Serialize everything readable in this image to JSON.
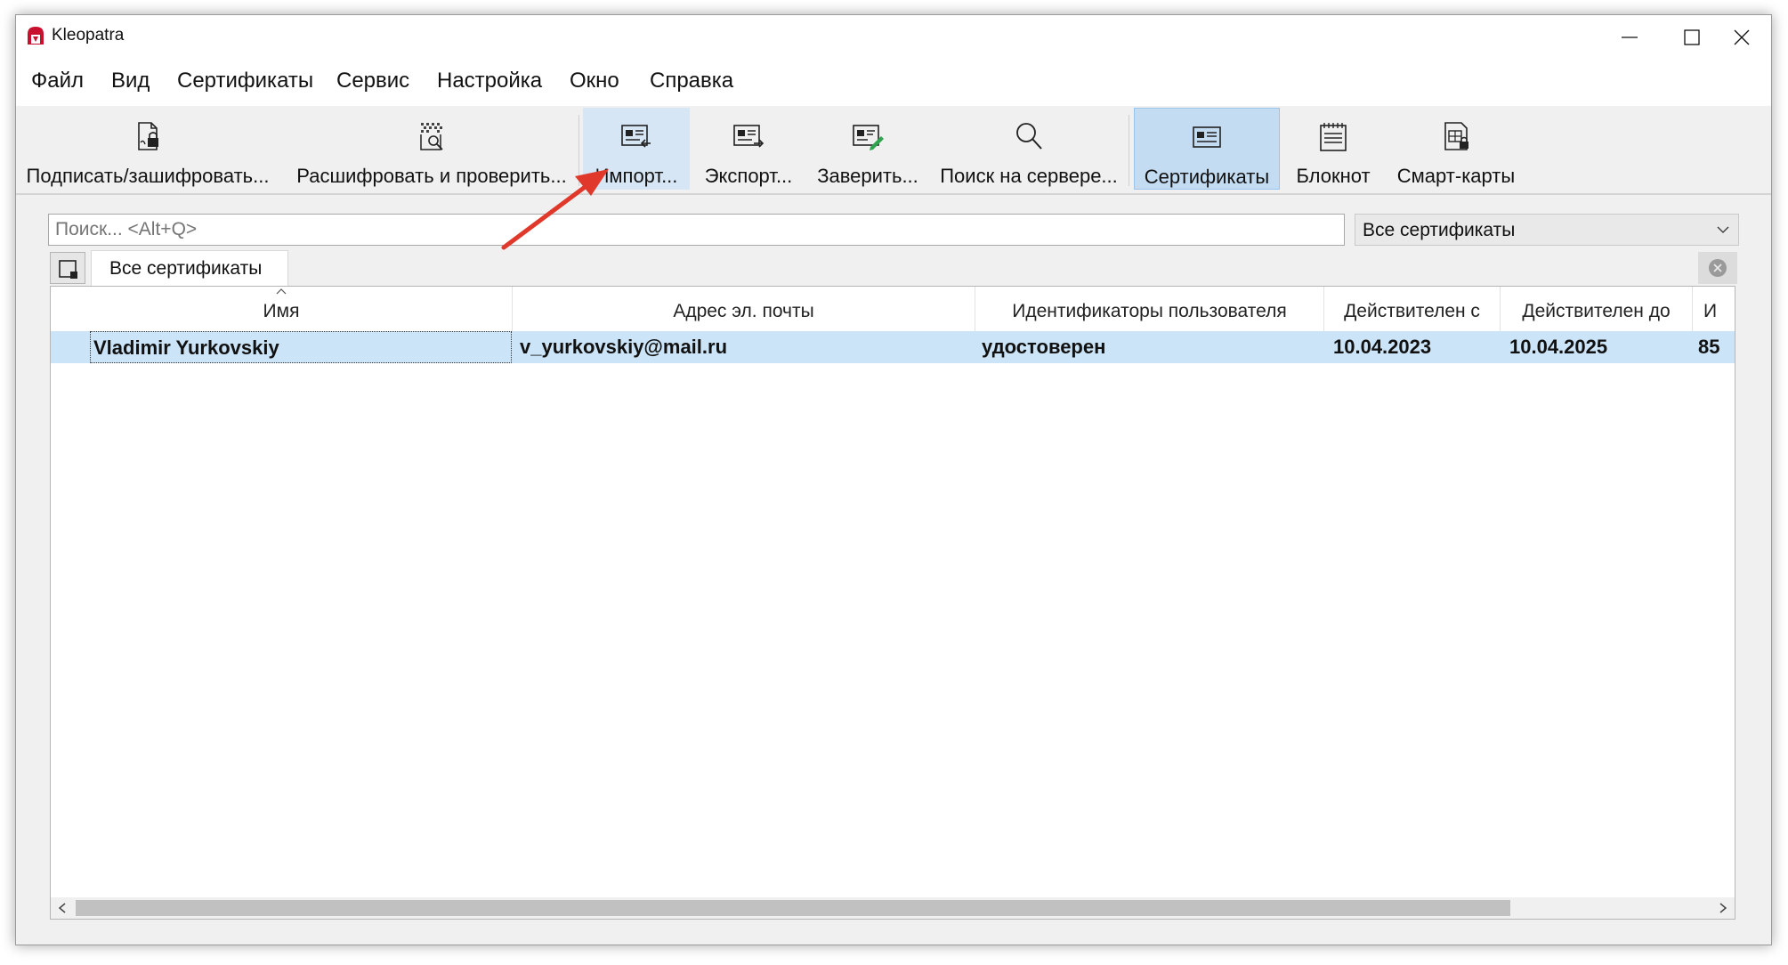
{
  "window": {
    "title": "Kleopatra"
  },
  "menubar": {
    "items": [
      "Файл",
      "Вид",
      "Сертификаты",
      "Сервис",
      "Настройка",
      "Окно",
      "Справка"
    ]
  },
  "toolbar": {
    "sign_encrypt": "Подписать/зашифровать...",
    "decrypt_verify": "Расшифровать и проверить...",
    "import": "Импорт...",
    "export": "Экспорт...",
    "certify": "Заверить...",
    "lookup": "Поиск на сервере...",
    "certificates": "Сертификаты",
    "notepad": "Блокнот",
    "smartcards": "Смарт-карты"
  },
  "search": {
    "placeholder": "Поиск... <Alt+Q>",
    "value": ""
  },
  "filter": {
    "selected": "Все сертификаты"
  },
  "tabs": [
    {
      "label": "Все сертификаты"
    }
  ],
  "table": {
    "columns": [
      "Имя",
      "Адрес эл. почты",
      "Идентификаторы пользователя",
      "Действителен с",
      "Действителен до",
      "И"
    ],
    "rows": [
      {
        "name": "Vladimir Yurkovskiy",
        "email": "v_yurkovskiy@mail.ru",
        "user_ids": "удостоверен",
        "valid_from": "10.04.2023",
        "valid_until": "10.04.2025",
        "id": "85"
      }
    ]
  },
  "colors": {
    "selection": "#cce4f7",
    "toolbar_active": "#c4dcf2",
    "annotation_arrow": "#e0392b"
  }
}
